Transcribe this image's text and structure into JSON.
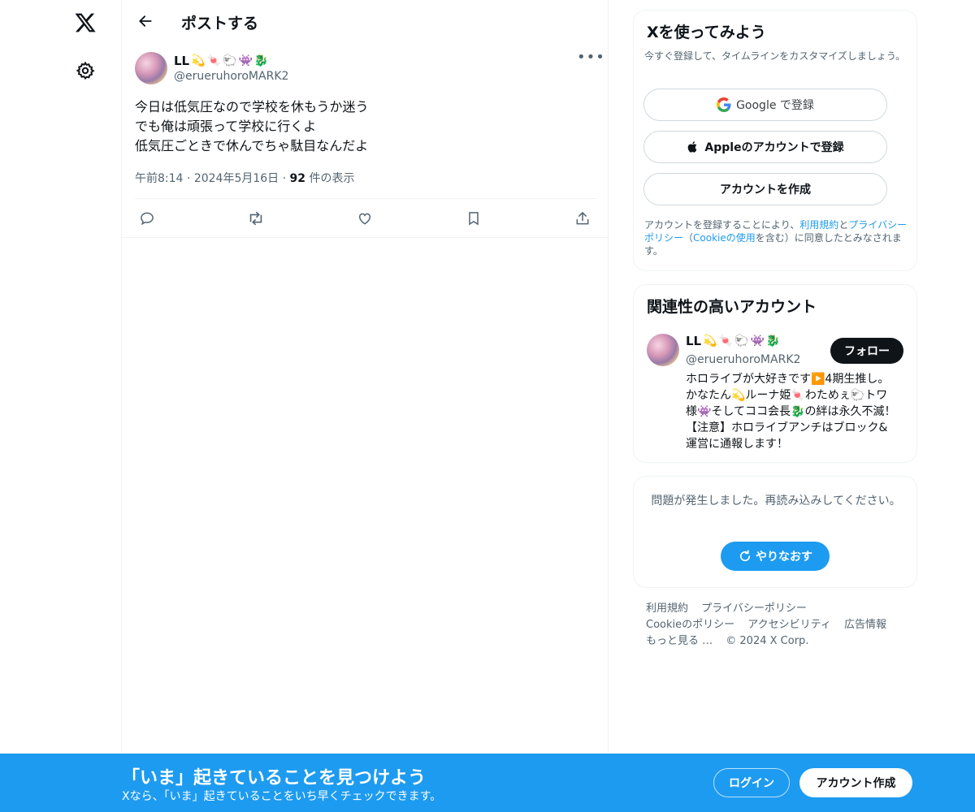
{
  "nav": {
    "logo_icon": "x-logo-icon",
    "settings_icon": "gear-icon"
  },
  "header": {
    "back_icon": "arrow-left-icon",
    "title": "ポストする"
  },
  "post": {
    "author_name": "LL",
    "author_emojis": [
      "💫",
      "🍬",
      "🐑",
      "👾",
      "🐉"
    ],
    "author_handle": "@erueruhoroMARK2",
    "text_lines": [
      "今日は低気圧なので学校を休もうか迷う",
      "でも俺は頑張って学校に行くよ",
      "低気圧ごときで休んでちゃ駄目なんだよ"
    ],
    "time": "午前8:14",
    "date": "2024年5月16日",
    "views_count": "92",
    "views_label": "件の表示",
    "separator": "·"
  },
  "signup": {
    "title": "Xを使ってみよう",
    "subtitle": "今すぐ登録して、タイムラインをカスタマイズしましょう。",
    "google_label": "Google で登録",
    "apple_label": "Appleのアカウントで登録",
    "create_label": "アカウントを作成",
    "terms_pre": "アカウントを登録することにより、",
    "terms_link1": "利用規約",
    "terms_and": "と",
    "terms_link2": "プライバシーポリシー",
    "terms_paren_open": "（",
    "terms_link3": "Cookieの使用",
    "terms_post": "を含む）に同意したとみなされます。"
  },
  "related": {
    "title": "関連性の高いアカウント",
    "name": "LL",
    "emojis": [
      "💫",
      "🍬",
      "🐑",
      "👾",
      "🐉"
    ],
    "handle": "@erueruhoroMARK2",
    "follow_label": "フォロー",
    "bio": "ホロライブが大好きです▶️4期生推し。かなたん💫ルーナ姫🍬わためぇ🐑トワ様👾そしてココ会長🐉の絆は永久不滅！【注意】ホロライブアンチはブロック&運営に通報します！"
  },
  "error": {
    "message": "問題が発生しました。再読み込みしてください。",
    "retry_label": "やりなおす"
  },
  "footer": {
    "terms": "利用規約",
    "privacy": "プライバシーポリシー",
    "cookie": "Cookieのポリシー",
    "accessibility": "アクセシビリティ",
    "ads": "広告情報",
    "more": "もっと見る …",
    "copyright": "© 2024 X Corp."
  },
  "bottom_bar": {
    "title": "「いま」起きていることを見つけよう",
    "subtitle": "Xなら、「いま」起きていることをいち早くチェックできます。",
    "login_label": "ログイン",
    "create_label": "アカウント作成"
  },
  "colors": {
    "accent": "#1d9bf0",
    "text": "#0f1419",
    "muted": "#536471",
    "border": "#eff3f4"
  }
}
